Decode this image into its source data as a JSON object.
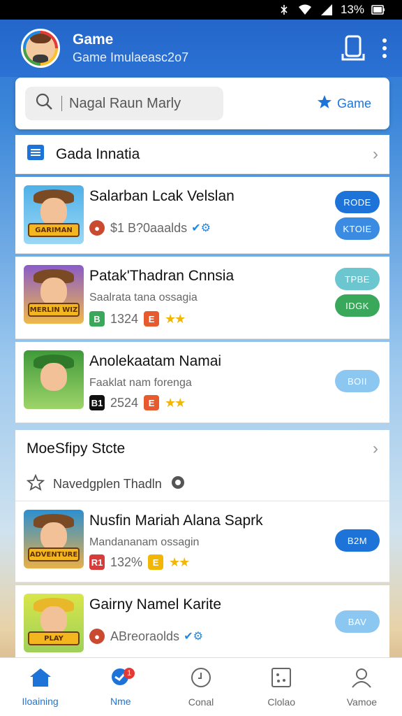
{
  "status": {
    "battery": "13%"
  },
  "header": {
    "title": "Game",
    "subtitle": "Game Imulaeasc2o7"
  },
  "search": {
    "placeholder": "Nagal Raun Marly",
    "game_link": "Game"
  },
  "section1": {
    "title": "Gada Innatia"
  },
  "items": [
    {
      "title": "Salarban Lcak Velslan",
      "meta": "$1 B?0aaalds",
      "thumb_text": "GARIMAN",
      "buttons": [
        "RODE",
        "KTOIE"
      ]
    },
    {
      "title": "Patak'Thadran Cnnsia",
      "sub": "Saalrata tana ossagia",
      "rating": "1324",
      "thumb_text": "MERLIN WIZ",
      "buttons": [
        "TPBE",
        "IDGK"
      ]
    },
    {
      "title": "Anolekaatam Namai",
      "sub": "Faaklat nam forenga",
      "rating": "2524",
      "mini": "B1",
      "buttons": [
        "BOII"
      ]
    }
  ],
  "section2": {
    "title": "MoeSfipy Stcte",
    "subrow": "Navedgplen Thadln"
  },
  "items2": [
    {
      "title": "Nusfin Mariah Alana Saprk",
      "sub": "Mandananam ossagin",
      "rating": "132%",
      "mini": "R1",
      "thumb_text": "ADVENTURE",
      "buttons": [
        "B2M"
      ]
    },
    {
      "title": "Gairny Namel Karite",
      "meta": "ABreoraolds",
      "thumb_text": "PLAY",
      "buttons": [
        "BAV"
      ]
    }
  ],
  "tabs": [
    {
      "label": "Iloaining",
      "icon": "home-icon"
    },
    {
      "label": "Nme",
      "icon": "chat-icon",
      "badge": "1"
    },
    {
      "label": "Conal",
      "icon": "clock-icon"
    },
    {
      "label": "Clolao",
      "icon": "grid-icon"
    },
    {
      "label": "Vamoe",
      "icon": "user-icon"
    }
  ],
  "colors": {
    "accent": "#2466c9",
    "pill_blue": "#1e73d8",
    "pill_teal": "#6cc6cf",
    "pill_green": "#3aa85a",
    "pill_light": "#8cc7f2"
  }
}
